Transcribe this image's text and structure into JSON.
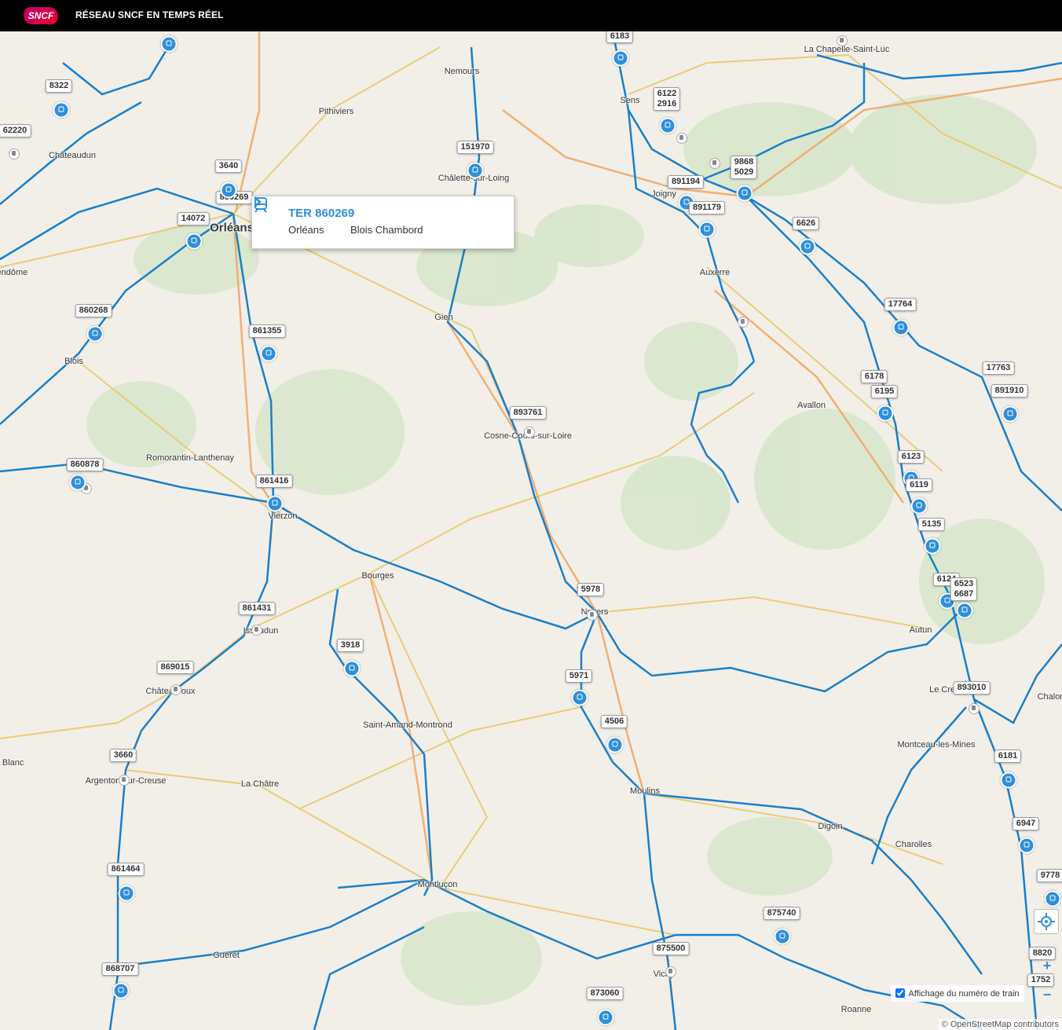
{
  "header": {
    "logo": "SNCF",
    "title": "RÉSEAU SNCF EN TEMPS RÉEL"
  },
  "popup": {
    "train": "TER 860269",
    "from": "Orléans",
    "to": "Blois Chambord"
  },
  "cities": [
    "La Chapelle-Saint-Luc",
    "Nemours",
    "Sens",
    "Pithiviers",
    "Châteaudun",
    "Châlette-sur-Loing",
    "Joigny",
    "Orléans",
    "Auxerre",
    "Gien",
    "Blois",
    "Avallon",
    "Cosne-Cours-sur-Loire",
    "Romorantin-Lanthenay",
    "Vierzon",
    "Bourges",
    "Nevers",
    "Autun",
    "Issoudun",
    "Châteauroux",
    "Le Creusot",
    "Saint-Amand-Montrond",
    "Montceau-les-Mines",
    "Argenton-sur-Creuse",
    "La Châtre",
    "Moulins",
    "Digoin",
    "Charolles",
    "Montluçon",
    "Guéret",
    "Vichy",
    "Roanne",
    "Vendôme",
    "Le Blanc",
    "Chalon"
  ],
  "trains": [
    [
      "6183"
    ],
    [
      "8322"
    ],
    [
      "62220"
    ],
    [
      "6122",
      "2916"
    ],
    [
      "151970"
    ],
    [
      "3640"
    ],
    [
      "9868",
      "5029"
    ],
    [
      "891194"
    ],
    [
      "860269"
    ],
    [
      "891179"
    ],
    [
      "14072"
    ],
    [
      "6626"
    ],
    [
      "860268"
    ],
    [
      "17764"
    ],
    [
      "861355"
    ],
    [
      "17763"
    ],
    [
      "6178"
    ],
    [
      "6195"
    ],
    [
      "891910"
    ],
    [
      "893761"
    ],
    [
      "6123"
    ],
    [
      "860878"
    ],
    [
      "861416"
    ],
    [
      "6119"
    ],
    [
      "5135"
    ],
    [
      "6124"
    ],
    [
      "6523",
      "6687"
    ],
    [
      "5978"
    ],
    [
      "861431"
    ],
    [
      "3918"
    ],
    [
      "869015"
    ],
    [
      "5971"
    ],
    [
      "893010"
    ],
    [
      "4506"
    ],
    [
      "3660"
    ],
    [
      "6181"
    ],
    [
      "6947"
    ],
    [
      "861464"
    ],
    [
      "9778"
    ],
    [
      "875740"
    ],
    [
      "875500"
    ],
    [
      "868707"
    ],
    [
      "873060"
    ],
    [
      "8820"
    ],
    [
      "1752"
    ]
  ],
  "controls": {
    "toggle_label": "Affichage du numéro de train",
    "zoom_in": "+",
    "zoom_out": "−",
    "attribution": "© OpenStreetMap contributors"
  },
  "colors": {
    "rail": "#1a7fc9",
    "marker": "#2f8fdb",
    "road_major": "#f0a867",
    "road_minor": "#e8c96a",
    "land": "#f2efe9",
    "forest": "#d4e6c8"
  },
  "icons": {
    "train_marker": "train-icon",
    "station": "station-icon",
    "locate": "crosshair-icon",
    "arrow": "chevron-right-icon"
  }
}
